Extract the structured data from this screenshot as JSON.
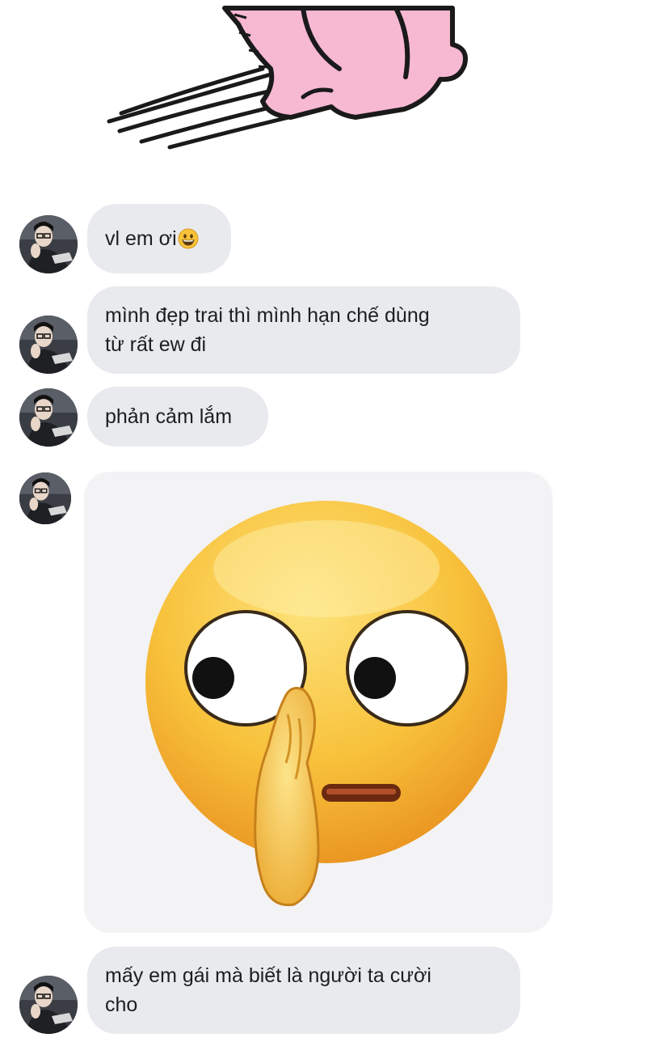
{
  "messages": [
    {
      "type": "text",
      "text": "vl em ơi",
      "emoji": "grinning-face-icon"
    },
    {
      "type": "text",
      "text": "mình đẹp trai thì mình hạn chế dùng\ntừ rất ew đi"
    },
    {
      "type": "text",
      "text": "phản cảm lắm"
    },
    {
      "type": "image",
      "content": "face-with-hand-over-eye-emoji"
    },
    {
      "type": "text",
      "text": "mấy em gái mà biết là người ta cười\ncho"
    }
  ],
  "colors": {
    "bubble": "#e9eaee",
    "text": "#1c1e21",
    "sticker_pink": "#f7b8d2",
    "emoji_yellow": "#f7c23a"
  }
}
